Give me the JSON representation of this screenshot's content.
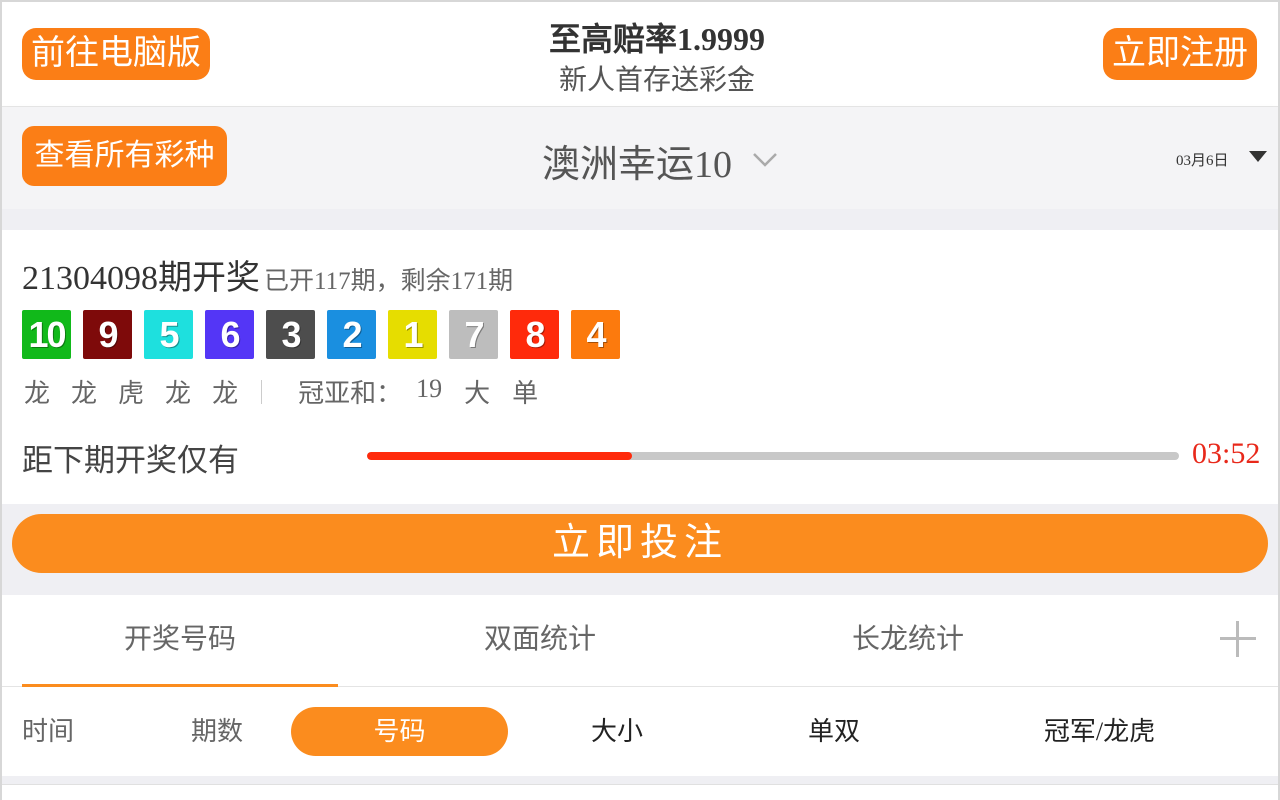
{
  "promo": {
    "desktop_label": "前往电脑版",
    "title": "至高赔率1.9999",
    "subtitle": "新人首存送彩金",
    "register_label": "立即注册",
    "accent": "#fb7e16"
  },
  "selector": {
    "all_label": "查看所有彩种",
    "lottery_name": "澳洲幸运10",
    "date": "03月6日"
  },
  "result": {
    "issue": "21304098期开奖",
    "info": "已开117期，剩余171期",
    "balls": [
      {
        "num": "10",
        "color": "#11b91a"
      },
      {
        "num": "9",
        "color": "#7e0a0a"
      },
      {
        "num": "5",
        "color": "#1ee0de"
      },
      {
        "num": "6",
        "color": "#5436f6"
      },
      {
        "num": "3",
        "color": "#4d4d4d"
      },
      {
        "num": "2",
        "color": "#1a8fe0"
      },
      {
        "num": "1",
        "color": "#e6dd00"
      },
      {
        "num": "7",
        "color": "#bdbdbd"
      },
      {
        "num": "8",
        "color": "#ff2a0b"
      },
      {
        "num": "4",
        "color": "#fc7a0d"
      }
    ],
    "dragon_tiger": [
      "龙",
      "龙",
      "虎",
      "龙",
      "龙"
    ],
    "sum_label": "冠亚和：",
    "sum_value": "19",
    "sum_size": "大",
    "sum_parity": "单"
  },
  "countdown": {
    "label": "距下期开奖仅有",
    "time": "03:52",
    "progress": 0.326
  },
  "bet_label": "立即投注",
  "tabs": [
    "开奖号码",
    "双面统计",
    "长龙统计"
  ],
  "filters": [
    "时间",
    "期数",
    "号码",
    "大小",
    "单双",
    "冠军/龙虎"
  ]
}
